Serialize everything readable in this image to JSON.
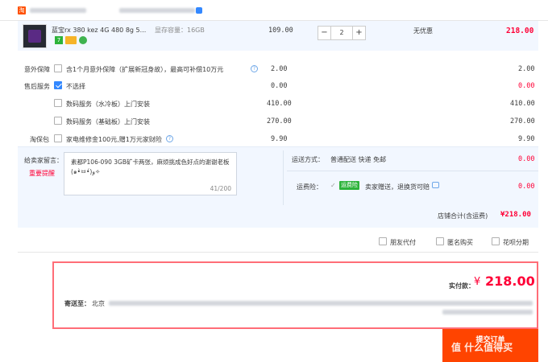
{
  "shop": {
    "badge": "淘"
  },
  "item": {
    "title": "蓝宝rx 380 kez 4G 480 8g 5...",
    "spec": "显存容量：16GB",
    "unit_price": "109.00",
    "qty_minus": "−",
    "quantity": "2",
    "qty_plus": "+",
    "discount": "无优惠",
    "subtotal": "218.00",
    "tag_7": "7",
    "accent": "#ff0036"
  },
  "services": {
    "accident_label": "意外保障",
    "accident_option": "含1个月意外保障（扩展新冠身故），最高可补偿10万元",
    "accident_price": "2.00",
    "accident_total": "2.00",
    "after_label": "售后服务",
    "after_none": "不选择",
    "after_none_price": "0.00",
    "after_none_total": "0.00",
    "after_opt1": "数码服务（水冷板）上门安装",
    "after_opt1_price": "410.00",
    "after_opt1_total": "410.00",
    "after_opt2": "数码服务（基础板）上门安装",
    "after_opt2_price": "270.00",
    "after_opt2_total": "270.00",
    "tbb_label": "淘保包",
    "tbb_option": "家电维修金100元,赠1万元家财险",
    "tbb_price": "9.90",
    "tbb_total": "9.90",
    "q_mark": "?"
  },
  "message": {
    "label": "给卖家留言：",
    "reminder": "重要提醒",
    "text": "素都P106-090 3GB矿卡两张，麻烦挑成色好点的谢谢老板(๑•̀ㅂ•́)و✧",
    "counter": "41/200"
  },
  "shipping": {
    "label": "运送方式：",
    "method": "普通配送 快递 免邮",
    "price": "0.00",
    "ins_label": "运费险：",
    "ins_badge": "运费险",
    "ins_desc": "卖家赠送，退换货可赔",
    "ins_price": "0.00"
  },
  "store_total": {
    "label": "店铺合计(含运费)",
    "value": "¥218.00"
  },
  "options": {
    "friend_pay": "朋友代付",
    "anonymous": "匿名购买",
    "huabei": "花呗分期"
  },
  "summary": {
    "paid_label": "实付款：",
    "currency": "¥",
    "paid_value": "218.00",
    "ship_to_label": "寄送至：",
    "city": "北京"
  },
  "submit": {
    "label": "提交订单"
  },
  "watermark": {
    "text": "值 什么值得买"
  }
}
